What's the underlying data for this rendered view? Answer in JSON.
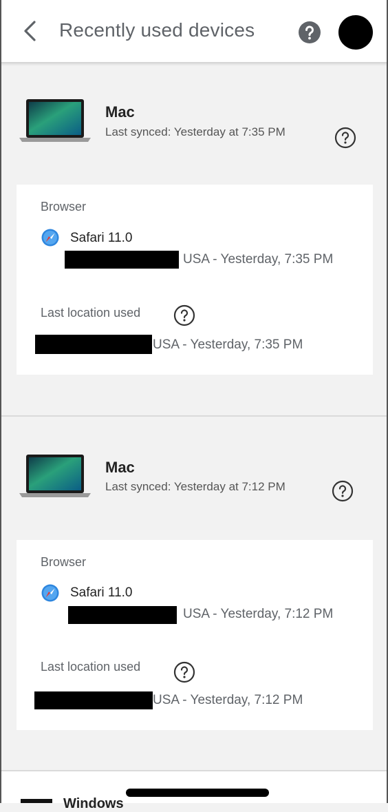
{
  "header": {
    "title": "Recently used devices"
  },
  "devices": [
    {
      "name": "Mac",
      "synced": "Last synced: Yesterday at 7:35 PM",
      "browser_label": "Browser",
      "browser": "Safari 11.0",
      "browser_location": "USA - Yesterday, 7:35 PM",
      "location_label": "Last location used",
      "last_location": "USA - Yesterday, 7:35 PM"
    },
    {
      "name": "Mac",
      "synced": "Last synced: Yesterday at 7:12 PM",
      "browser_label": "Browser",
      "browser": "Safari 11.0",
      "browser_location": "USA - Yesterday, 7:12 PM",
      "location_label": "Last location used",
      "last_location": "USA - Yesterday, 7:12 PM"
    }
  ],
  "partial_device": {
    "name": "Windows"
  },
  "icons": {
    "back": "back-arrow-icon",
    "help": "help-icon",
    "device": "laptop-icon",
    "browser": "safari-icon",
    "info": "question-circle-icon"
  },
  "colors": {
    "background": "#f2f2f2",
    "card": "#ffffff",
    "title": "#5f6368",
    "safari_blue": "#2e86de"
  }
}
